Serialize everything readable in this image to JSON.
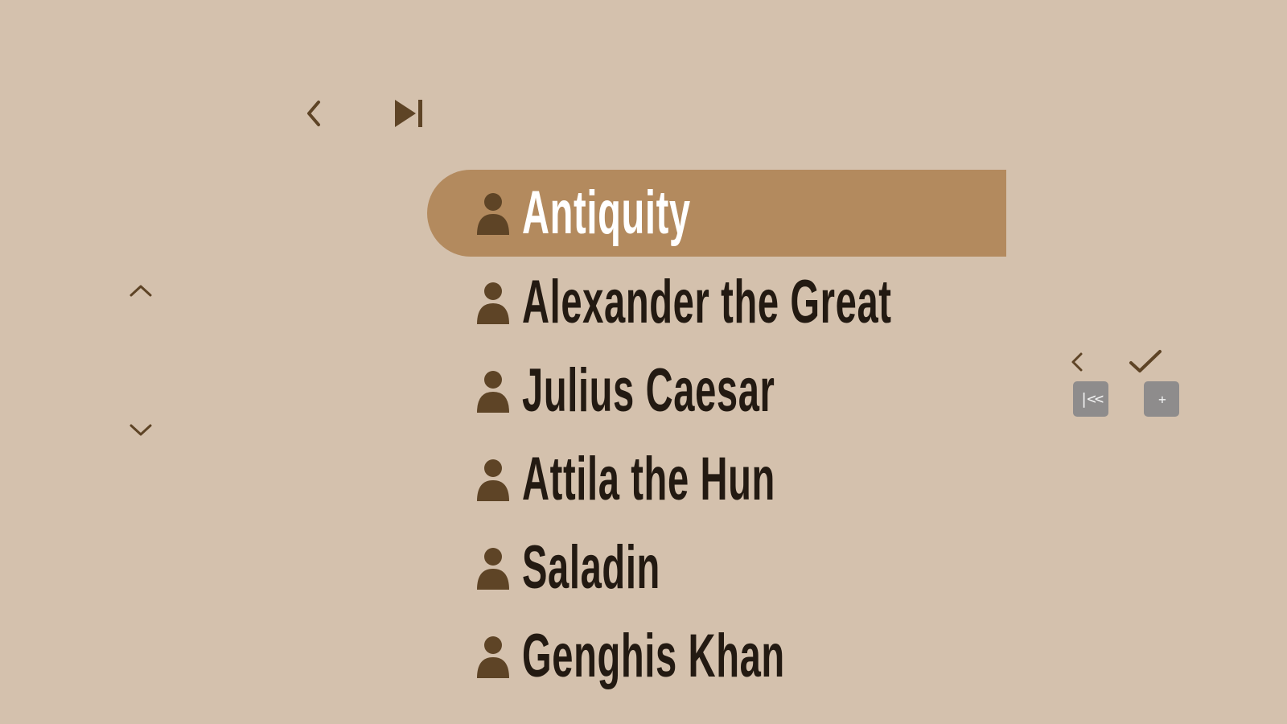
{
  "navigation": {
    "back_icon": "chevron-left-icon",
    "skip_icon": "skip-to-end-icon",
    "up_icon": "chevron-up-icon",
    "down_icon": "chevron-down-icon"
  },
  "list": {
    "item_icon": "person-icon",
    "selected_index": 0,
    "items": [
      {
        "label": "Antiquity"
      },
      {
        "label": "Alexander the Great"
      },
      {
        "label": "Julius Caesar"
      },
      {
        "label": "Attila the Hun"
      },
      {
        "label": "Saladin"
      },
      {
        "label": "Genghis Khan"
      }
    ]
  },
  "mini_controls": {
    "back_icon": "chevron-left-icon",
    "confirm_icon": "checkmark-icon",
    "first_key": "|<<",
    "plus_key": "+"
  },
  "colors": {
    "background": "#d4c1ad",
    "highlight": "#b38a5e",
    "icon": "#5e4426",
    "text": "#231a12",
    "selected_text": "#ffffff",
    "key_badge": "#8e8c8c"
  }
}
